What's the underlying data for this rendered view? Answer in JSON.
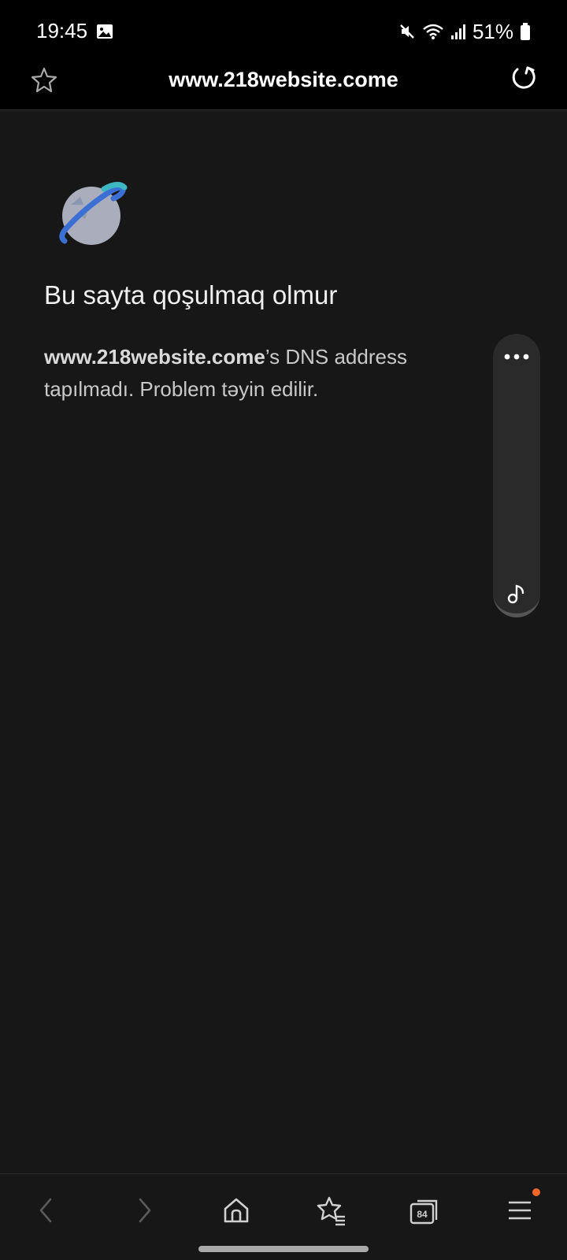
{
  "status_bar": {
    "time": "19:45",
    "battery": "51%",
    "icons": [
      "gallery-notification-icon",
      "mute-icon",
      "wifi-icon",
      "signal-icon",
      "battery-icon"
    ]
  },
  "toolbar": {
    "url": "www.218website.come",
    "bookmark_icon": "star-outline-icon",
    "reload_icon": "reload-icon"
  },
  "error_page": {
    "icon": "globe-icon",
    "title": "Bu sayta qoşulmaq olmur",
    "url_bold": "www.218website.come",
    "message_rest": "’s DNS address tapılmadı. Problem təyin edilir."
  },
  "side_panel": {
    "more_icon": "more-dots-icon",
    "music_icon": "music-note-icon"
  },
  "bottom_nav": {
    "items": [
      "back",
      "forward",
      "home",
      "bookmarks",
      "tabs",
      "menu"
    ],
    "tab_count": "84",
    "menu_badge_color": "#f0662a"
  }
}
